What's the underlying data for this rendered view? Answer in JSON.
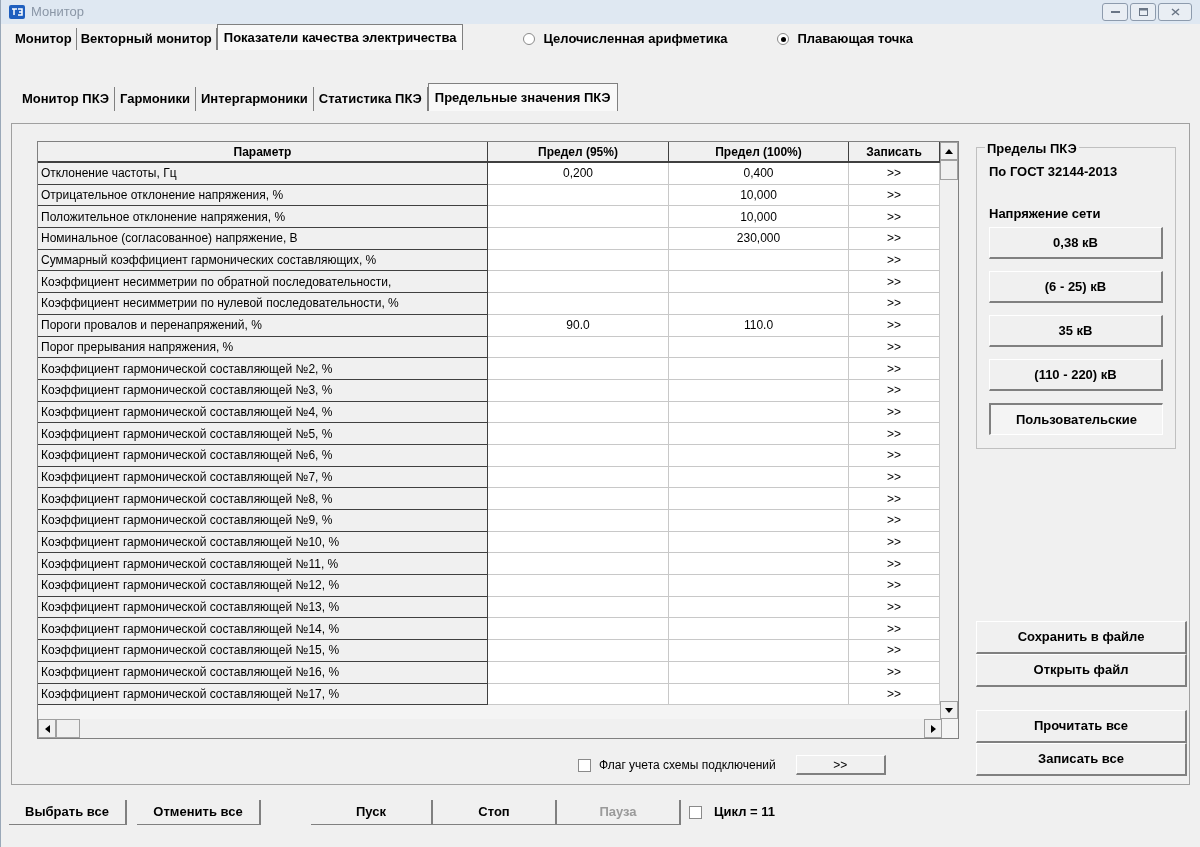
{
  "window": {
    "title": "Монитор"
  },
  "main_tabs": [
    {
      "label": "Монитор",
      "selected": false
    },
    {
      "label": "Векторный монитор",
      "selected": false
    },
    {
      "label": "Показатели качества электричества",
      "selected": true
    }
  ],
  "arithmetic_mode": [
    {
      "label": "Целочисленная арифметика",
      "selected": false
    },
    {
      "label": "Плавающая точка",
      "selected": true
    }
  ],
  "sub_tabs": [
    {
      "label": "Монитор ПКЭ",
      "selected": false
    },
    {
      "label": "Гармоники",
      "selected": false
    },
    {
      "label": "Интергармоники",
      "selected": false
    },
    {
      "label": "Статистика ПКЭ",
      "selected": false
    },
    {
      "label": "Предельные значения ПКЭ",
      "selected": true
    }
  ],
  "table": {
    "columns": [
      "Параметр",
      "Предел (95%)",
      "Предел (100%)",
      "Записать"
    ],
    "rows": [
      {
        "parameter": "Отклонение частоты, Гц",
        "limit_95": "0,200",
        "limit_100": "0,400",
        "write": ">>"
      },
      {
        "parameter": "Отрицательное отклонение напряжения, %",
        "limit_100": "10,000",
        "write": ">>"
      },
      {
        "parameter": "Положительное отклонение напряжения, %",
        "limit_100": "10,000",
        "write": ">>"
      },
      {
        "parameter": "Номинальное (согласованное) напряжение, В",
        "limit_100": "230,000",
        "write": ">>"
      },
      {
        "parameter": "Суммарный коэффициент гармонических составляющих, %",
        "write": ">>"
      },
      {
        "parameter": "Коэффициент несимметрии по обратной последовательности,",
        "write": ">>"
      },
      {
        "parameter": "Коэффициент несимметрии по нулевой последовательности, %",
        "write": ">>"
      },
      {
        "parameter": "Пороги провалов и перенапряжений, %",
        "limit_95": "90.0",
        "limit_100": "110.0",
        "write": ">>"
      },
      {
        "parameter": "Порог прерывания напряжения, %",
        "write": ">>"
      },
      {
        "parameter": "Коэффициент гармонической составляющей №2, %",
        "write": ">>"
      },
      {
        "parameter": "Коэффициент гармонической составляющей №3, %",
        "write": ">>"
      },
      {
        "parameter": "Коэффициент гармонической составляющей №4, %",
        "write": ">>"
      },
      {
        "parameter": "Коэффициент гармонической составляющей №5, %",
        "write": ">>"
      },
      {
        "parameter": "Коэффициент гармонической составляющей №6, %",
        "write": ">>"
      },
      {
        "parameter": "Коэффициент гармонической составляющей №7, %",
        "write": ">>"
      },
      {
        "parameter": "Коэффициент гармонической составляющей №8, %",
        "write": ">>"
      },
      {
        "parameter": "Коэффициент гармонической составляющей №9, %",
        "write": ">>"
      },
      {
        "parameter": "Коэффициент гармонической составляющей №10, %",
        "write": ">>"
      },
      {
        "parameter": "Коэффициент гармонической составляющей №11, %",
        "write": ">>"
      },
      {
        "parameter": "Коэффициент гармонической составляющей №12, %",
        "write": ">>"
      },
      {
        "parameter": "Коэффициент гармонической составляющей №13, %",
        "write": ">>"
      },
      {
        "parameter": "Коэффициент гармонической составляющей №14, %",
        "write": ">>"
      },
      {
        "parameter": "Коэффициент гармонической составляющей №15, %",
        "write": ">>"
      },
      {
        "parameter": "Коэффициент гармонической составляющей №16, %",
        "write": ">>"
      },
      {
        "parameter": "Коэффициент гармонической составляющей №17, %",
        "write": ">>"
      }
    ]
  },
  "limits_group": {
    "title": "Пределы ПКЭ",
    "standard": "По ГОСТ 32144-2013",
    "voltage_label": "Напряжение сети",
    "voltage_buttons": [
      {
        "label": "0,38 кВ",
        "selected": false
      },
      {
        "label": "(6 - 25) кВ",
        "selected": false
      },
      {
        "label": "35 кВ",
        "selected": false
      },
      {
        "label": "(110 - 220) кВ",
        "selected": false
      },
      {
        "label": "Пользовательские",
        "selected": true
      }
    ]
  },
  "file_buttons": [
    "Сохранить в файле",
    "Открыть файл"
  ],
  "device_buttons": [
    "Прочитать все",
    "Записать все"
  ],
  "connection_flag": {
    "label": "Флаг учета схемы подключений",
    "checked": false,
    "button": ">>"
  },
  "toolbar": {
    "buttons": [
      {
        "label": "Выбрать все",
        "disabled": false
      },
      {
        "label": "Отменить все",
        "disabled": false
      },
      {
        "label": "Пуск",
        "disabled": false
      },
      {
        "label": "Стоп",
        "disabled": false
      },
      {
        "label": "Пауза",
        "disabled": true
      }
    ],
    "cycle": {
      "label": "Цикл = 11",
      "checked": false
    }
  }
}
